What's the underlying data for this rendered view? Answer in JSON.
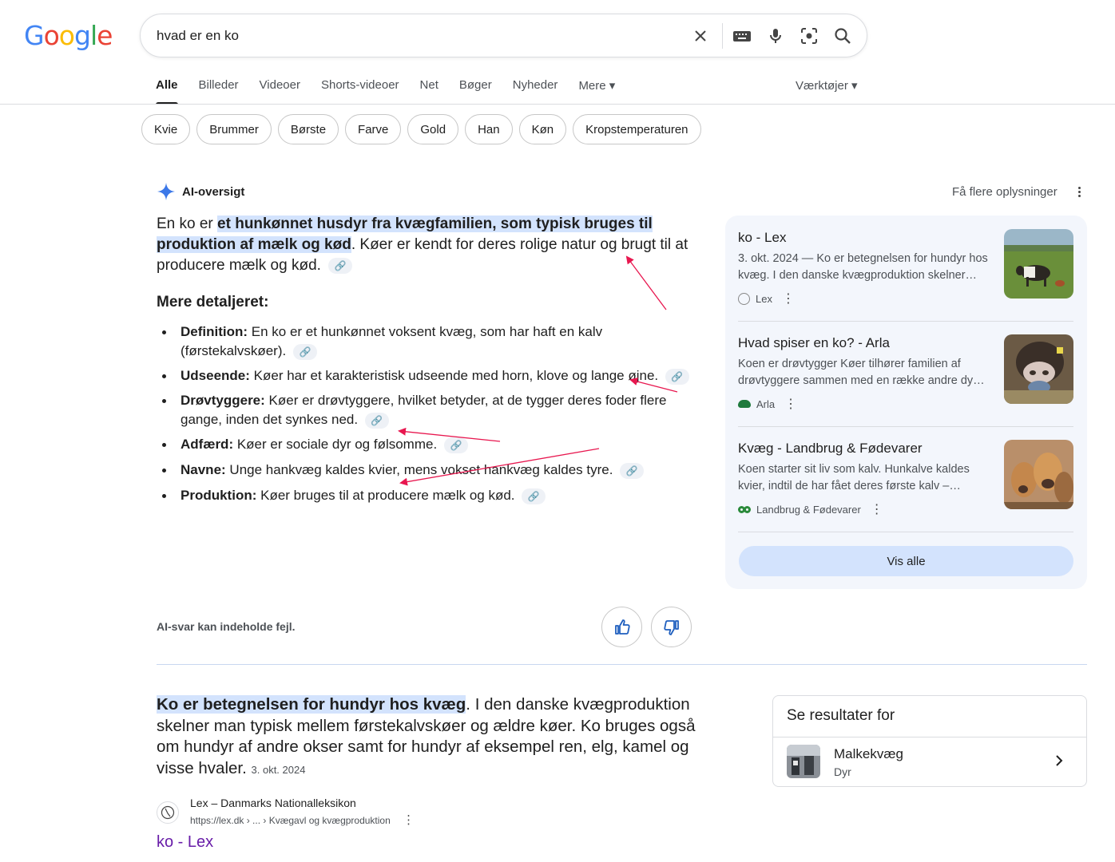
{
  "header": {
    "logo": "Google",
    "search_value": "hvad er en ko",
    "colors": {
      "blue": "#4285F4",
      "red": "#EA4335",
      "yellow": "#FBBC05",
      "green": "#34A853"
    },
    "icons": [
      "close-icon",
      "keyboard-icon",
      "microphone-icon",
      "lens-icon",
      "search-icon"
    ]
  },
  "tabs": [
    {
      "label": "Alle",
      "active": true
    },
    {
      "label": "Billeder"
    },
    {
      "label": "Videoer"
    },
    {
      "label": "Shorts-videoer"
    },
    {
      "label": "Net"
    },
    {
      "label": "Bøger"
    },
    {
      "label": "Nyheder"
    },
    {
      "label": "Mere ▾"
    }
  ],
  "tools_label": "Værktøjer ▾",
  "chips": [
    "Kvie",
    "Brummer",
    "Børste",
    "Farve",
    "Gold",
    "Han",
    "Køn",
    "Kropstemperaturen"
  ],
  "ai": {
    "label": "AI-oversigt",
    "more_info": "Få flere oplysninger",
    "intro_prefix": "En ko er ",
    "intro_highlight": "et hunkønnet husdyr fra kvægfamilien, som typisk bruges til produktion af mælk og kød",
    "intro_suffix": ". Køer er kendt for deres rolige natur og brugt til at producere mælk og kød.",
    "details_title": "Mere detaljeret:",
    "bullets": [
      {
        "term": "Definition:",
        "text": " En ko er et hunkønnet voksent kvæg, som har haft en kalv (førstekalvskøer)."
      },
      {
        "term": "Udseende:",
        "text": " Køer har et karakteristisk udseende med horn, klove og lange øjne."
      },
      {
        "term": "Drøvtyggere:",
        "text": " Køer er drøvtyggere, hvilket betyder, at de tygger deres foder flere gange, inden det synkes ned."
      },
      {
        "term": "Adfærd:",
        "text": " Køer er sociale dyr og følsomme."
      },
      {
        "term": "Navne:",
        "text": " Unge hankvæg kaldes kvier, mens vokset hankvæg kaldes tyre."
      },
      {
        "term": "Produktion:",
        "text": " Køer bruges til at producere mælk og kød."
      }
    ],
    "disclaimer": "AI-svar kan indeholde fejl.",
    "annotation_color": "#e8174f"
  },
  "sources": {
    "items": [
      {
        "title": "ko - Lex",
        "snippet": "3. okt. 2024 — Ko er betegnelsen for hundyr hos kvæg. I den danske kvægproduktion skelner…",
        "site": "Lex"
      },
      {
        "title": "Hvad spiser en ko? - Arla",
        "snippet": "Koen er drøvtygger Køer tilhører familien af drøvtyggere sammen med en række andre dy…",
        "site": "Arla"
      },
      {
        "title": "Kvæg - Landbrug & Fødevarer",
        "snippet": "Koen starter sit liv som kalv. Hunkalve kaldes kvier, indtil de har fået deres første kalv –…",
        "site": "Landbrug & Fødevarer"
      }
    ],
    "show_all": "Vis alle"
  },
  "featured": {
    "highlight": "Ko er betegnelsen for hundyr hos kvæg",
    "text": ". I den danske kvægproduktion skelner man typisk mellem førstekalvskøer og ældre køer. Ko bruges også om hundyr af andre okser samt for hundyr af eksempel ren, elg, kamel og visse hvaler.",
    "date": "3. okt. 2024",
    "site_name": "Lex – Danmarks Nationalleksikon",
    "site_url": "https://lex.dk › ... › Kvægavl og kvægproduktion",
    "title": "ko - Lex"
  },
  "see_results": {
    "title": "Se resultater for",
    "item_name": "Malkekvæg",
    "item_sub": "Dyr"
  }
}
